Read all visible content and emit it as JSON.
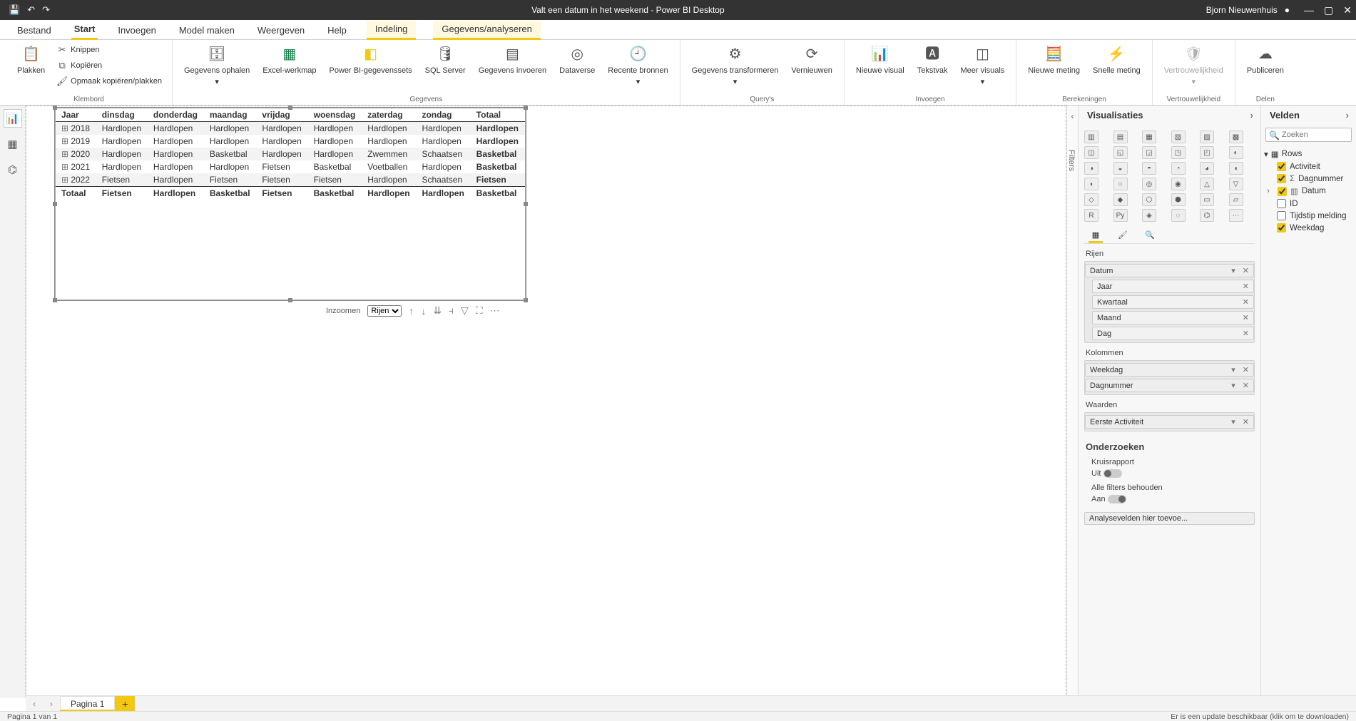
{
  "titlebar": {
    "title": "Valt een datum in het weekend - Power BI Desktop",
    "user": "Bjorn Nieuwenhuis",
    "qat": {
      "save": "💾",
      "undo": "↶",
      "redo": "↷"
    },
    "win": {
      "min": "—",
      "max": "▢",
      "close": "✕"
    }
  },
  "ribbon_tabs": [
    "Bestand",
    "Start",
    "Invoegen",
    "Model maken",
    "Weergeven",
    "Help",
    "Indeling",
    "Gegevens/analyseren"
  ],
  "ribbon_tabs_active": "Start",
  "ribbon_tabs_context": [
    "Indeling",
    "Gegevens/analyseren"
  ],
  "ribbon_groups": {
    "klembord": {
      "label": "Klembord",
      "paste": "Plakken",
      "cut": "Knippen",
      "copy": "Kopiëren",
      "format": "Opmaak kopiëren/plakken"
    },
    "gegevens": {
      "label": "Gegevens",
      "get": "Gegevens ophalen",
      "excel": "Excel-werkmap",
      "pbi": "Power BI-gegevenssets",
      "sql": "SQL Server",
      "enter": "Gegevens invoeren",
      "dataverse": "Dataverse",
      "recent": "Recente bronnen"
    },
    "querys": {
      "label": "Query's",
      "transform": "Gegevens transformeren",
      "refresh": "Vernieuwen"
    },
    "invoegen": {
      "label": "Invoegen",
      "newvisual": "Nieuwe visual",
      "textbox": "Tekstvak",
      "morevisuals": "Meer visuals"
    },
    "berekeningen": {
      "label": "Berekeningen",
      "newmeasure": "Nieuwe meting",
      "quickmeasure": "Snelle meting"
    },
    "vertrouwelijkheid": {
      "label": "Vertrouwelijkheid",
      "sensitivity": "Vertrouwelijkheid"
    },
    "delen": {
      "label": "Delen",
      "publish": "Publiceren"
    }
  },
  "matrix": {
    "columns": [
      "Jaar",
      "dinsdag",
      "donderdag",
      "maandag",
      "vrijdag",
      "woensdag",
      "zaterdag",
      "zondag",
      "Totaal"
    ],
    "rows": [
      {
        "year": "2018",
        "cells": [
          "Hardlopen",
          "Hardlopen",
          "Hardlopen",
          "Hardlopen",
          "Hardlopen",
          "Hardlopen",
          "Hardlopen",
          "Hardlopen"
        ]
      },
      {
        "year": "2019",
        "cells": [
          "Hardlopen",
          "Hardlopen",
          "Hardlopen",
          "Hardlopen",
          "Hardlopen",
          "Hardlopen",
          "Hardlopen",
          "Hardlopen"
        ]
      },
      {
        "year": "2020",
        "cells": [
          "Hardlopen",
          "Hardlopen",
          "Basketbal",
          "Hardlopen",
          "Hardlopen",
          "Zwemmen",
          "Schaatsen",
          "Basketbal"
        ]
      },
      {
        "year": "2021",
        "cells": [
          "Hardlopen",
          "Hardlopen",
          "Hardlopen",
          "Fietsen",
          "Basketbal",
          "Voetballen",
          "Hardlopen",
          "Basketbal"
        ]
      },
      {
        "year": "2022",
        "cells": [
          "Fietsen",
          "Hardlopen",
          "Fietsen",
          "Fietsen",
          "Fietsen",
          "Hardlopen",
          "Schaatsen",
          "Fietsen"
        ]
      }
    ],
    "total_row": {
      "label": "Totaal",
      "cells": [
        "Fietsen",
        "Hardlopen",
        "Basketbal",
        "Fietsen",
        "Basketbal",
        "Hardlopen",
        "Hardlopen",
        "Basketbal"
      ]
    }
  },
  "visual_toolbar": {
    "inzoom_label": "Inzoomen",
    "inzoom_value": "Rijen"
  },
  "filters_label": "Filters",
  "viz_pane": {
    "title": "Visualisaties",
    "sections": {
      "rows": "Rijen",
      "columns": "Kolommen",
      "values": "Waarden",
      "drill": "Onderzoeken",
      "crossreport": "Kruisrapport",
      "off": "Uit",
      "keepfilters": "Alle filters behouden",
      "on": "Aan",
      "addfields": "Analysevelden hier toevoe..."
    },
    "wells": {
      "rows_top": "Datum",
      "rows_sub": [
        "Jaar",
        "Kwartaal",
        "Maand",
        "Dag"
      ],
      "columns": [
        "Weekdag",
        "Dagnummer"
      ],
      "values": [
        "Eerste Activiteit"
      ]
    }
  },
  "fields_pane": {
    "title": "Velden",
    "search_placeholder": "Zoeken",
    "table": "Rows",
    "fields": [
      {
        "name": "Activiteit",
        "checked": true,
        "icon": ""
      },
      {
        "name": "Dagnummer",
        "checked": true,
        "icon": "Σ"
      },
      {
        "name": "Datum",
        "checked": true,
        "icon": "hier",
        "hier": true
      },
      {
        "name": "ID",
        "checked": false,
        "icon": ""
      },
      {
        "name": "Tijdstip melding",
        "checked": false,
        "icon": ""
      },
      {
        "name": "Weekdag",
        "checked": true,
        "icon": ""
      }
    ]
  },
  "page_tabs": {
    "page1": "Pagina 1"
  },
  "status": {
    "left": "Pagina 1 van 1",
    "right": "Er is een update beschikbaar (klik om te downloaden)"
  }
}
